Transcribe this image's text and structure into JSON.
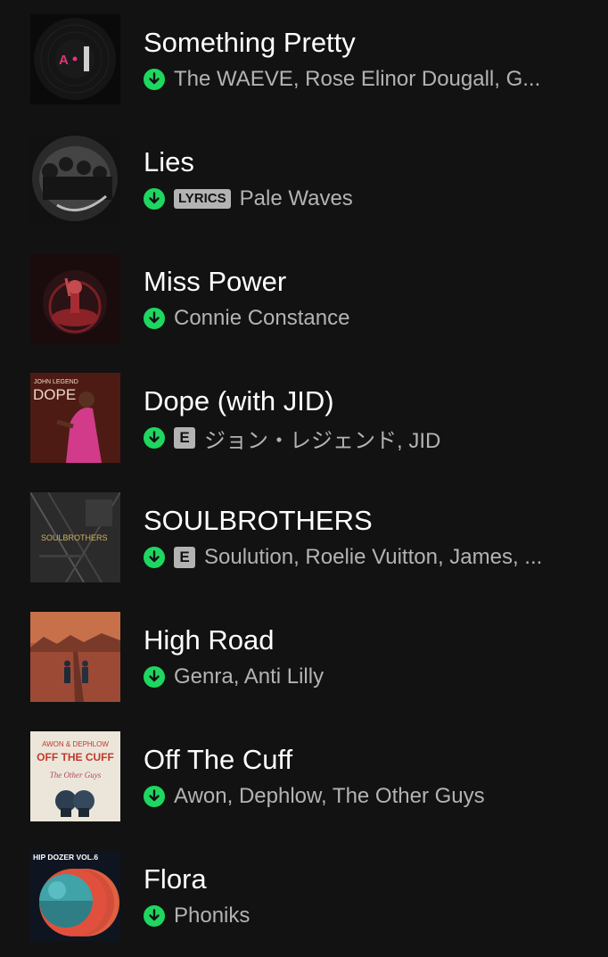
{
  "colors": {
    "background": "#121212",
    "title": "#ffffff",
    "subtitle": "#b3b3b3",
    "downloaded": "#1ed760"
  },
  "tracks": [
    {
      "title": "Something Pretty",
      "artists": "The WAEVE, Rose Elinor Dougall, G...",
      "downloaded": true
    },
    {
      "title": "Lies",
      "artists": "Pale Waves",
      "downloaded": true,
      "badge": "LYRICS"
    },
    {
      "title": "Miss Power",
      "artists": "Connie Constance",
      "downloaded": true
    },
    {
      "title": "Dope (with JID)",
      "artists": "ジョン・レジェンド, JID",
      "downloaded": true,
      "explicit": "E"
    },
    {
      "title": "SOULBROTHERS",
      "artists": "Soulution, Roelie Vuitton, James, ...",
      "downloaded": true,
      "explicit": "E"
    },
    {
      "title": "High Road",
      "artists": "Genra, Anti Lilly",
      "downloaded": true
    },
    {
      "title": "Off The Cuff",
      "artists": "Awon, Dephlow, The Other Guys",
      "downloaded": true
    },
    {
      "title": "Flora",
      "artists": "Phoniks",
      "downloaded": true
    }
  ],
  "artwork_text": {
    "dope_artist": "JOHN LEGEND",
    "dope_title": "DOPE",
    "soulbrothers": "SOULBROTHERS",
    "cuff_top": "AWON & DEPHLOW",
    "cuff_title": "OFF THE CUFF",
    "cuff_script": "The Other Guys",
    "flora_top": "HIP DOZER VOL.6"
  }
}
